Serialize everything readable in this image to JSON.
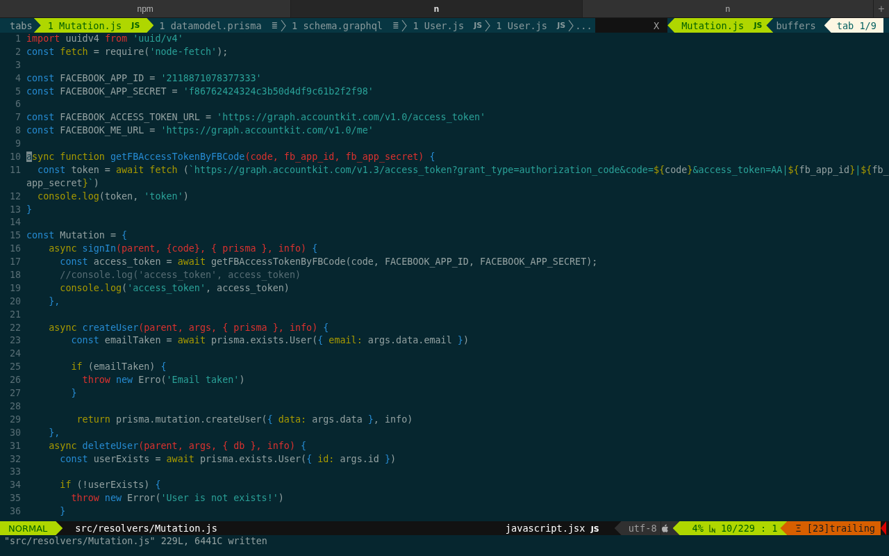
{
  "terminal_tabs": [
    {
      "label": "npm",
      "selected": false
    },
    {
      "label": "n",
      "selected": true
    },
    {
      "label": "n",
      "selected": false
    }
  ],
  "new_tab_button": "+",
  "tabline": {
    "label": "tabs",
    "buffers": [
      {
        "label": "1 Mutation.js",
        "icon": "JS",
        "selected": true
      },
      {
        "label": "1 datamodel.prisma",
        "icon": "≣",
        "selected": false
      },
      {
        "label": "1 schema.graphql",
        "icon": "≣",
        "selected": false
      },
      {
        "label": "1 User.js",
        "icon": "JS",
        "selected": false
      },
      {
        "label": "1 User.js",
        "icon": "JS",
        "selected": false
      }
    ],
    "overflow": "...",
    "close": "X",
    "current": "Mutation.js",
    "current_icon": "JS",
    "buffers_label": "buffers",
    "tab_counter": "tab 1/9"
  },
  "code": [
    {
      "number": "1",
      "tokens": [
        {
          "t": "import",
          "kind": "red"
        },
        {
          "t": " uuidv4 ",
          "kind": "p"
        },
        {
          "t": "from",
          "kind": "red"
        },
        {
          "t": " 'uuid/v4'",
          "kind": "str"
        }
      ]
    },
    {
      "number": "2",
      "tokens": [
        {
          "t": "const",
          "kind": "blue"
        },
        {
          "t": " fetch",
          "kind": "olive"
        },
        {
          "t": " = require(",
          "kind": "p"
        },
        {
          "t": "'node-fetch'",
          "kind": "str"
        },
        {
          "t": ");",
          "kind": "p"
        }
      ]
    },
    {
      "number": "3"
    },
    {
      "number": "4",
      "tokens": [
        {
          "t": "const",
          "kind": "blue"
        },
        {
          "t": " FACEBOOK_APP_ID = ",
          "kind": "p"
        },
        {
          "t": "'2118871078377333'",
          "kind": "str"
        }
      ]
    },
    {
      "number": "5",
      "tokens": [
        {
          "t": "const",
          "kind": "blue"
        },
        {
          "t": " FACEBOOK_APP_SECRET = ",
          "kind": "p"
        },
        {
          "t": "'f86762424324c3b50d4df9c61b2f2f98'",
          "kind": "str"
        }
      ]
    },
    {
      "number": "6"
    },
    {
      "number": "7",
      "tokens": [
        {
          "t": "const",
          "kind": "blue"
        },
        {
          "t": " FACEBOOK_ACCESS_TOKEN_URL = ",
          "kind": "p"
        },
        {
          "t": "'https://graph.accountkit.com/v1.0/access_token'",
          "kind": "str"
        }
      ]
    },
    {
      "number": "8",
      "tokens": [
        {
          "t": "const",
          "kind": "blue"
        },
        {
          "t": " FACEBOOK_ME_URL = ",
          "kind": "p"
        },
        {
          "t": "'https://graph.accountkit.com/v1.0/me'",
          "kind": "str"
        }
      ]
    },
    {
      "number": "9"
    },
    {
      "number": "10",
      "tokens": [
        {
          "t": "a",
          "kind": "cursor"
        },
        {
          "t": "sync function",
          "kind": "olive"
        },
        {
          "t": " getFBAccessTokenByFBCode",
          "kind": "blue"
        },
        {
          "t": "(code, fb_app_id, fb_app_secret)",
          "kind": "red"
        },
        {
          "t": " {",
          "kind": "blue"
        }
      ]
    },
    {
      "number": "11",
      "tokens": [
        {
          "t": "  const",
          "kind": "blue"
        },
        {
          "t": " token = ",
          "kind": "p"
        },
        {
          "t": "await fetch",
          "kind": "olive"
        },
        {
          "t": " (",
          "kind": "p"
        },
        {
          "t": "`https://graph.accountkit.com/v1.3/access_token?grant_type=authorization_code&code=",
          "kind": "str"
        },
        {
          "t": "${",
          "kind": "olive"
        },
        {
          "t": "code",
          "kind": "p"
        },
        {
          "t": "}",
          "kind": "olive"
        },
        {
          "t": "&access_token=AA|",
          "kind": "str"
        },
        {
          "t": "${",
          "kind": "olive"
        },
        {
          "t": "fb_app_id",
          "kind": "p"
        },
        {
          "t": "}",
          "kind": "olive"
        },
        {
          "t": "|",
          "kind": "str"
        },
        {
          "t": "${",
          "kind": "olive"
        },
        {
          "t": "fb_",
          "kind": "p"
        }
      ]
    },
    {
      "tokens": [
        {
          "t": "app_secret",
          "kind": "p"
        },
        {
          "t": "}",
          "kind": "olive"
        },
        {
          "t": "`",
          "kind": "str"
        },
        {
          "t": ")",
          "kind": "p"
        }
      ]
    },
    {
      "number": "12",
      "tokens": [
        {
          "t": "  console.log",
          "kind": "olive"
        },
        {
          "t": "(token, ",
          "kind": "p"
        },
        {
          "t": "'token'",
          "kind": "str"
        },
        {
          "t": ")",
          "kind": "p"
        }
      ]
    },
    {
      "number": "13",
      "tokens": [
        {
          "t": "}",
          "kind": "blue"
        }
      ]
    },
    {
      "number": "14"
    },
    {
      "number": "15",
      "tokens": [
        {
          "t": "const",
          "kind": "blue"
        },
        {
          "t": " Mutation = ",
          "kind": "p"
        },
        {
          "t": "{",
          "kind": "blue"
        }
      ]
    },
    {
      "number": "16",
      "tokens": [
        {
          "t": "    async",
          "kind": "olive"
        },
        {
          "t": " signIn",
          "kind": "blue"
        },
        {
          "t": "(parent, {code}, { prisma }, info)",
          "kind": "red"
        },
        {
          "t": " {",
          "kind": "blue"
        }
      ]
    },
    {
      "number": "17",
      "tokens": [
        {
          "t": "      const",
          "kind": "blue"
        },
        {
          "t": " access_token = ",
          "kind": "p"
        },
        {
          "t": "await",
          "kind": "olive"
        },
        {
          "t": " getFBAccessTokenByFBCode(code, FACEBOOK_APP_ID, FACEBOOK_APP_SECRET);",
          "kind": "p"
        }
      ]
    },
    {
      "number": "18",
      "tokens": [
        {
          "t": "      //console.log('access_token', access_token)",
          "kind": "comment"
        }
      ]
    },
    {
      "number": "19",
      "tokens": [
        {
          "t": "      console.log",
          "kind": "olive"
        },
        {
          "t": "(",
          "kind": "p"
        },
        {
          "t": "'access_token'",
          "kind": "str"
        },
        {
          "t": ", access_token)",
          "kind": "p"
        }
      ]
    },
    {
      "number": "20",
      "tokens": [
        {
          "t": "    },",
          "kind": "blue"
        }
      ]
    },
    {
      "number": "21"
    },
    {
      "number": "22",
      "tokens": [
        {
          "t": "    async",
          "kind": "olive"
        },
        {
          "t": " createUser",
          "kind": "blue"
        },
        {
          "t": "(parent, args, { prisma }, info)",
          "kind": "red"
        },
        {
          "t": " {",
          "kind": "blue"
        }
      ]
    },
    {
      "number": "23",
      "tokens": [
        {
          "t": "        const",
          "kind": "blue"
        },
        {
          "t": " emailTaken = ",
          "kind": "p"
        },
        {
          "t": "await",
          "kind": "olive"
        },
        {
          "t": " prisma.exists.User(",
          "kind": "p"
        },
        {
          "t": "{",
          "kind": "blue"
        },
        {
          "t": " email:",
          "kind": "olive"
        },
        {
          "t": " args.data.email ",
          "kind": "p"
        },
        {
          "t": "}",
          "kind": "blue"
        },
        {
          "t": ")",
          "kind": "p"
        }
      ]
    },
    {
      "number": "24"
    },
    {
      "number": "25",
      "tokens": [
        {
          "t": "        if",
          "kind": "olive"
        },
        {
          "t": " (emailTaken) ",
          "kind": "p"
        },
        {
          "t": "{",
          "kind": "blue"
        }
      ]
    },
    {
      "number": "26",
      "tokens": [
        {
          "t": "          throw",
          "kind": "red"
        },
        {
          "t": " new",
          "kind": "blue"
        },
        {
          "t": " Erro(",
          "kind": "p"
        },
        {
          "t": "'Email taken'",
          "kind": "str"
        },
        {
          "t": ")",
          "kind": "p"
        }
      ]
    },
    {
      "number": "27",
      "tokens": [
        {
          "t": "        }",
          "kind": "blue"
        }
      ]
    },
    {
      "number": "28"
    },
    {
      "number": "29",
      "tokens": [
        {
          "t": "         return",
          "kind": "olive"
        },
        {
          "t": " prisma.mutation.createUser(",
          "kind": "p"
        },
        {
          "t": "{",
          "kind": "blue"
        },
        {
          "t": " data:",
          "kind": "olive"
        },
        {
          "t": " args.data ",
          "kind": "p"
        },
        {
          "t": "}",
          "kind": "blue"
        },
        {
          "t": ", info)",
          "kind": "p"
        }
      ]
    },
    {
      "number": "30",
      "tokens": [
        {
          "t": "    },",
          "kind": "blue"
        }
      ]
    },
    {
      "number": "31",
      "tokens": [
        {
          "t": "    async",
          "kind": "olive"
        },
        {
          "t": " deleteUser",
          "kind": "blue"
        },
        {
          "t": "(parent, args, { db }, info)",
          "kind": "red"
        },
        {
          "t": " {",
          "kind": "blue"
        }
      ]
    },
    {
      "number": "32",
      "tokens": [
        {
          "t": "      const",
          "kind": "blue"
        },
        {
          "t": " userExists = ",
          "kind": "p"
        },
        {
          "t": "await",
          "kind": "olive"
        },
        {
          "t": " prisma.exists.User(",
          "kind": "p"
        },
        {
          "t": "{",
          "kind": "blue"
        },
        {
          "t": " id:",
          "kind": "olive"
        },
        {
          "t": " args.id ",
          "kind": "p"
        },
        {
          "t": "}",
          "kind": "blue"
        },
        {
          "t": ")",
          "kind": "p"
        }
      ]
    },
    {
      "number": "33"
    },
    {
      "number": "34",
      "tokens": [
        {
          "t": "      if",
          "kind": "olive"
        },
        {
          "t": " (!userExists) ",
          "kind": "p"
        },
        {
          "t": "{",
          "kind": "blue"
        }
      ]
    },
    {
      "number": "35",
      "tokens": [
        {
          "t": "        throw",
          "kind": "red"
        },
        {
          "t": " new",
          "kind": "blue"
        },
        {
          "t": " Error(",
          "kind": "p"
        },
        {
          "t": "'User is not exists!'",
          "kind": "str"
        },
        {
          "t": ")",
          "kind": "p"
        }
      ]
    },
    {
      "number": "36",
      "tokens": [
        {
          "t": "      }",
          "kind": "blue"
        }
      ]
    }
  ],
  "statusline": {
    "mode": "NORMAL",
    "file": "src/resolvers/Mutation.js",
    "filetype": "javascript.jsx",
    "filetype_icon": "JS",
    "encoding": "utf-8",
    "percent": "4%",
    "position": "10/229",
    "separator": ":",
    "column": "1",
    "warning": "Ξ [23]trailing"
  },
  "message": "\"src/resolvers/Mutation.js\" 229L, 6441C written"
}
